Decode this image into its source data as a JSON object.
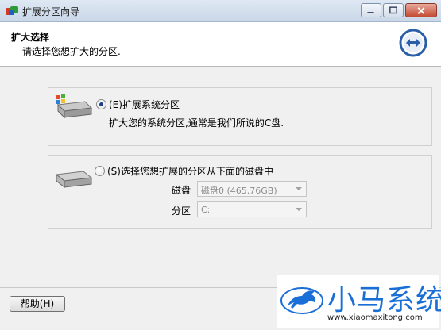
{
  "window": {
    "title": "扩展分区向导",
    "controls": {
      "minimize_icon": "minimize-icon",
      "maximize_icon": "maximize-icon",
      "close_icon": "close-icon"
    }
  },
  "header": {
    "title": "扩大选择",
    "subtitle": "请选择您想扩大的分区.",
    "icon": "expand-arrows-icon"
  },
  "options": [
    {
      "label": "(E)扩展系统分区",
      "description": "扩大您的系统分区,通常是我们所说的C盘.",
      "selected": true,
      "icon": "system-drive-icon"
    },
    {
      "label": "(S)选择您想扩展的分区从下面的磁盘中",
      "selected": false,
      "icon": "drive-icon",
      "fields": {
        "disk_label": "磁盘",
        "disk_value": "磁盘0 (465.76GB)",
        "partition_label": "分区",
        "partition_value": "C:"
      }
    }
  ],
  "footer": {
    "help_label": "帮助(H)"
  },
  "watermark": {
    "name": "小马系统",
    "url": "www.xiaomaxitong.com"
  },
  "colors": {
    "accent": "#1a6fd6",
    "title_bar": "#c9d7e8",
    "body": "#f0f0f0"
  }
}
